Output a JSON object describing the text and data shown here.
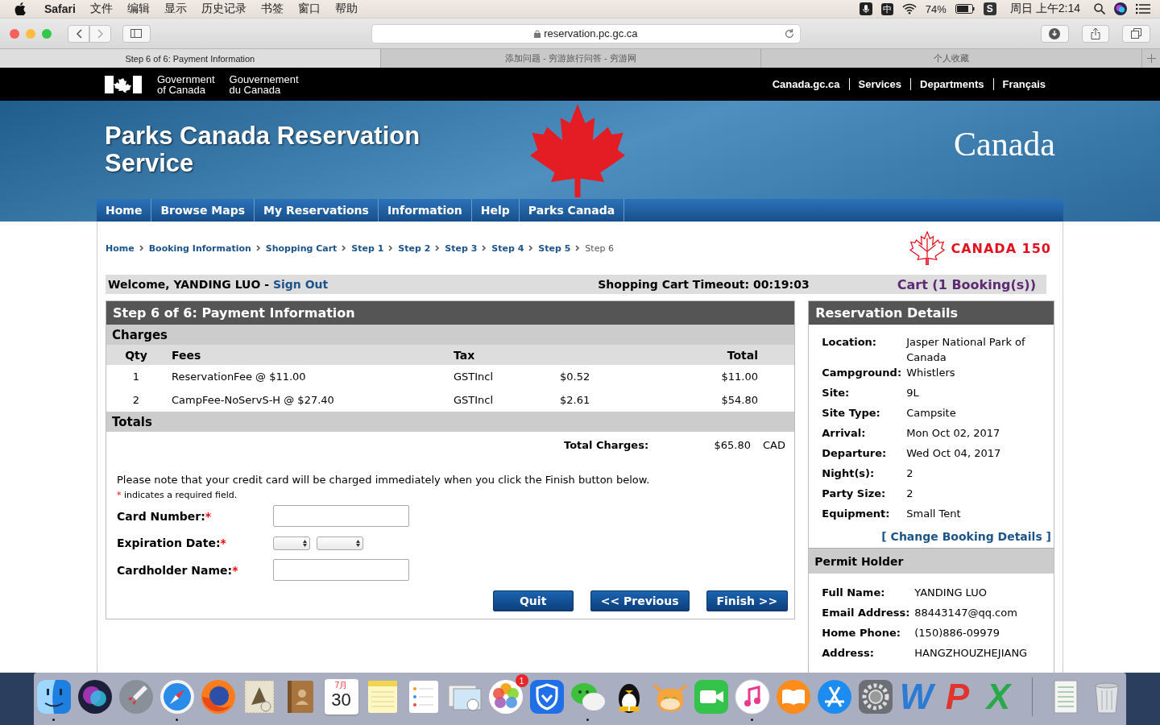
{
  "menubar": {
    "app": "Safari",
    "menus": [
      "文件",
      "编辑",
      "显示",
      "历史记录",
      "书签",
      "窗口",
      "帮助"
    ],
    "ime": "中",
    "battery": "74%",
    "app_glyph": "S",
    "clock": "周日 上午2:14"
  },
  "browser": {
    "url": "reservation.pc.gc.ca",
    "tabs": [
      {
        "title": "Step 6 of 6: Payment Information",
        "selected": true
      },
      {
        "title": "添加问题 - 穷游旅行问答 - 穷游网",
        "selected": false
      },
      {
        "title": "个人收藏",
        "selected": false
      }
    ]
  },
  "gov_bar": {
    "signature_en": [
      "Government",
      "of Canada"
    ],
    "signature_fr": [
      "Gouvernement",
      "du Canada"
    ],
    "links": [
      "Canada.gc.ca",
      "Services",
      "Departments",
      "Français"
    ]
  },
  "banner": {
    "title": "Parks Canada Reservation Service",
    "wordmark": "Canada"
  },
  "nav": [
    "Home",
    "Browse Maps",
    "My Reservations",
    "Information",
    "Help",
    "Parks Canada"
  ],
  "breadcrumb": [
    {
      "label": "Home",
      "link": true
    },
    {
      "label": "Booking Information",
      "link": true
    },
    {
      "label": "Shopping Cart",
      "link": true
    },
    {
      "label": "Step 1",
      "link": true
    },
    {
      "label": "Step 2",
      "link": true
    },
    {
      "label": "Step 3",
      "link": true
    },
    {
      "label": "Step 4",
      "link": true
    },
    {
      "label": "Step 5",
      "link": true
    },
    {
      "label": "Step 6",
      "link": false
    }
  ],
  "canada150": "CANADA 150",
  "welcome": {
    "text": "Welcome, YANDING LUO -",
    "link": "Sign Out",
    "timeout_label": "Shopping Cart Timeout:",
    "timeout": "00:19:03",
    "cart": "Cart (1 Booking(s))"
  },
  "payment": {
    "title": "Step 6 of 6: Payment Information",
    "charges_heading": "Charges",
    "columns": [
      "Qty",
      "Fees",
      "Tax",
      "Total"
    ],
    "rows": [
      {
        "qty": "1",
        "fee": "ReservationFee @ $11.00",
        "tax": "GSTIncl",
        "tax_amount": "$0.52",
        "total": "$11.00"
      },
      {
        "qty": "2",
        "fee": "CampFee-NoServS-H @ $27.40",
        "tax": "GSTIncl",
        "tax_amount": "$2.61",
        "total": "$54.80"
      }
    ],
    "totals_heading": "Totals",
    "total_label": "Total Charges:",
    "total_value": "$65.80",
    "currency": "CAD",
    "note": "Please note that your credit card will be charged immediately when you click the Finish button below.",
    "required_note": {
      "mark": "*",
      "text": "indicates a required field."
    },
    "fields": [
      {
        "label": "Card Number:",
        "mark": "*",
        "kind": "text"
      },
      {
        "label": "Expiration Date:",
        "mark": "*",
        "kind": "date"
      },
      {
        "label": "Cardholder Name:",
        "mark": "*",
        "kind": "text"
      }
    ],
    "buttons": [
      "Quit",
      "<< Previous",
      "Finish >>"
    ]
  },
  "details": {
    "title": "Reservation Details",
    "rows": [
      {
        "label": "Location:",
        "value": "Jasper National Park of Canada"
      },
      {
        "label": "Campground:",
        "value": "Whistlers"
      },
      {
        "label": "Site:",
        "value": "9L"
      },
      {
        "label": "Site Type:",
        "value": "Campsite"
      },
      {
        "label": "Arrival:",
        "value": "Mon Oct 02, 2017"
      },
      {
        "label": "Departure:",
        "value": "Wed Oct 04, 2017"
      },
      {
        "label": "Night(s):",
        "value": "2"
      },
      {
        "label": "Party Size:",
        "value": "2"
      },
      {
        "label": "Equipment:",
        "value": "Small Tent"
      }
    ],
    "change_link": "[ Change Booking Details ]",
    "permit_heading": "Permit Holder",
    "holder": [
      {
        "label": "Full Name:",
        "value": "YANDING LUO"
      },
      {
        "label": "Email Address:",
        "value": "88443147@qq.com"
      },
      {
        "label": "Home Phone:",
        "value": "(150)886-09979"
      },
      {
        "label": "Address:",
        "value": "HANGZHOUZHEJIANG"
      }
    ]
  },
  "dock": [
    {
      "kind": "finder",
      "running": true
    },
    {
      "kind": "siri",
      "running": false
    },
    {
      "kind": "launchpad",
      "running": false
    },
    {
      "kind": "safari",
      "running": true
    },
    {
      "kind": "firefox",
      "running": false
    },
    {
      "kind": "stamp",
      "running": false
    },
    {
      "kind": "contacts",
      "running": false
    },
    {
      "kind": "calendar",
      "running": false,
      "month": "7月",
      "day": "30"
    },
    {
      "kind": "notes",
      "running": false
    },
    {
      "kind": "reminders",
      "running": false
    },
    {
      "kind": "preview",
      "running": false
    },
    {
      "kind": "photos",
      "running": false,
      "badge": "1"
    },
    {
      "kind": "shield",
      "running": false
    },
    {
      "kind": "wechat",
      "running": true
    },
    {
      "kind": "penguin",
      "running": false
    },
    {
      "kind": "cow",
      "running": false
    },
    {
      "kind": "facetime",
      "running": false
    },
    {
      "kind": "itunes",
      "running": true
    },
    {
      "kind": "books",
      "running": false
    },
    {
      "kind": "appstore",
      "running": false
    },
    {
      "kind": "prefs",
      "running": false
    },
    {
      "kind": "letter",
      "running": false,
      "glyph": "W",
      "color": "#2b7bd6"
    },
    {
      "kind": "letter",
      "running": false,
      "glyph": "P",
      "color": "#e0342c"
    },
    {
      "kind": "letter",
      "running": false,
      "glyph": "X",
      "color": "#2aa84a"
    },
    {
      "kind": "separator"
    },
    {
      "kind": "document",
      "running": false
    },
    {
      "kind": "trash",
      "running": false
    }
  ]
}
